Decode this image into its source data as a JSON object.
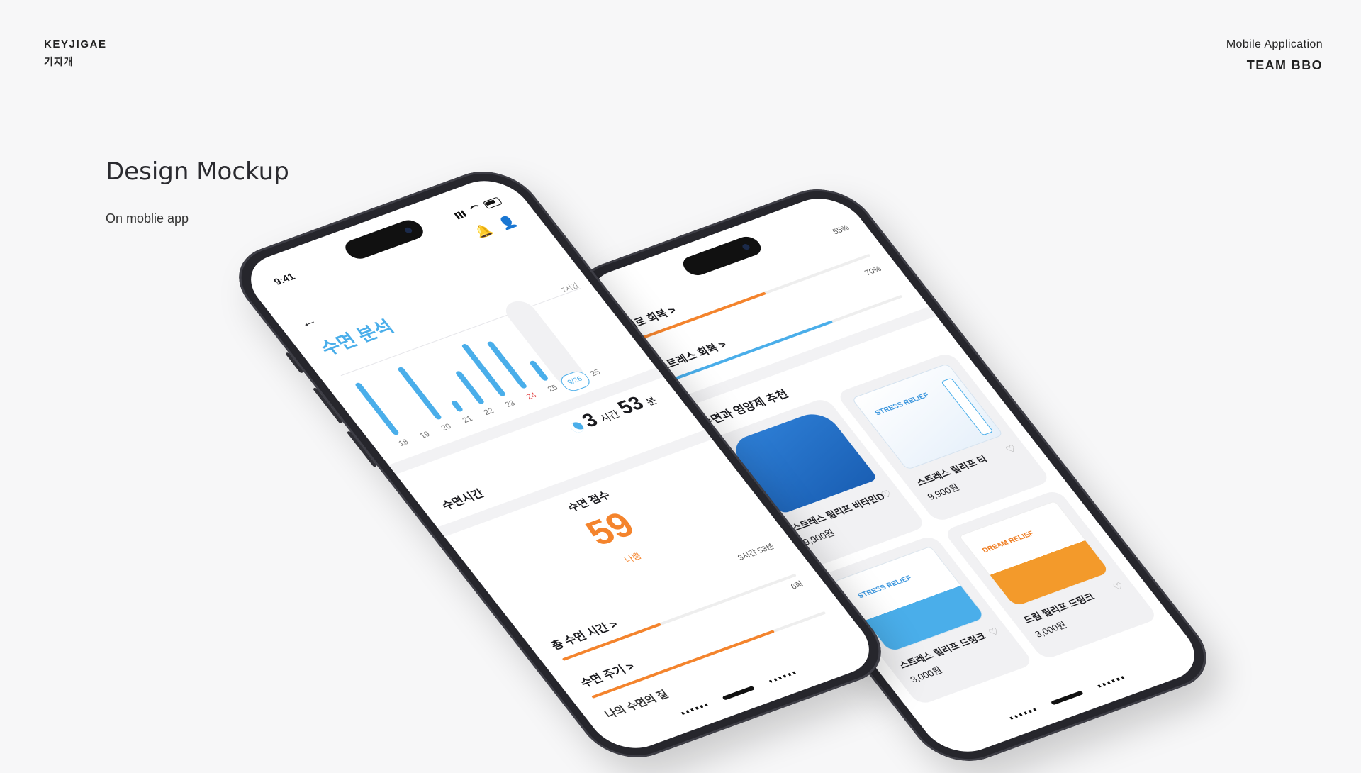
{
  "header": {
    "brand_en": "KEYJIGAE",
    "brand_kr": "기지개",
    "category": "Mobile Application",
    "team": "TEAM BBO"
  },
  "hero": {
    "title": "Design Mockup",
    "subtitle": "On moblie app"
  },
  "front_phone": {
    "time": "9:41",
    "icons": [
      "bell-icon",
      "user-icon"
    ],
    "back_icon": "←",
    "bell_icon": "🔔",
    "user_icon": "👤",
    "title": "수면 분석",
    "chart_data": {
      "type": "bar",
      "categories": [
        "18",
        "19",
        "20",
        "21",
        "22",
        "23",
        "24",
        "25",
        "9/26",
        "25"
      ],
      "values": [
        5.8,
        null,
        5.8,
        1.2,
        3.6,
        5.8,
        5.2,
        2.2
      ],
      "highlight_category": "9/26",
      "highlight_color": "#e14040",
      "red_tick": "24",
      "y_label": "7시간",
      "bar_color": "#4aaeea"
    },
    "sleep_time": {
      "label": "수면시간",
      "hours": "3",
      "hours_unit": "시간",
      "minutes": "53",
      "minutes_unit": "분"
    },
    "score": {
      "label": "수면 점수",
      "value": "59",
      "level": "나쁨"
    },
    "metrics": [
      {
        "label": "총 수면 시간 >",
        "value": "3시간 53분",
        "fill": 0.42,
        "color": "#f4842d"
      },
      {
        "label": "수면 주기 >",
        "value": "6회",
        "fill": 0.78,
        "color": "#f4842d"
      }
    ],
    "next_section": "나의 수면의 질"
  },
  "back_phone": {
    "rows": [
      {
        "label": "피로 회복 >",
        "pct": "55%",
        "fill": 0.55,
        "color": "#f4842d"
      },
      {
        "label": "스트레스 회복 >",
        "pct": "70%",
        "fill": 0.7,
        "color": "#4aaeea"
      }
    ],
    "rec_title": "수면과 영양제 추천",
    "products": [
      {
        "name": "스트레스 릴리프 비타민D",
        "price": "9,900원",
        "style": "p-blue",
        "pack_text": ""
      },
      {
        "name": "스트레스 릴리프 티",
        "price": "9,900원",
        "style": "p-box",
        "pack_text": "STRESS RELIEF"
      },
      {
        "name": "스트레스 릴리프 드링크",
        "price": "3,000원",
        "style": "p-pouch",
        "pack_text": "STRESS RELIEF"
      },
      {
        "name": "드림 릴리프 드링크",
        "price": "3,000원",
        "style": "p-orange",
        "pack_text": "DREAM RELIEF"
      }
    ],
    "heart_icon": "♡"
  }
}
